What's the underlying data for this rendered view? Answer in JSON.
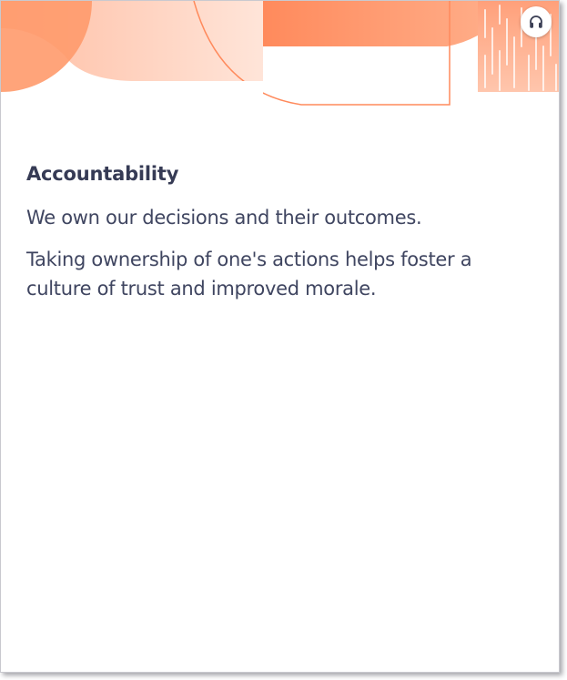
{
  "card": {
    "title": "Accountability",
    "paragraphs": [
      "We own our decisions and their outcomes.",
      "Taking ownership of one's actions helps foster a culture of trust and improved morale."
    ]
  },
  "header": {
    "audio_icon": "headphones-icon"
  },
  "colors": {
    "accent": "#ff8a5c",
    "accent_light": "#ffd2be",
    "text": "#3f4560"
  }
}
